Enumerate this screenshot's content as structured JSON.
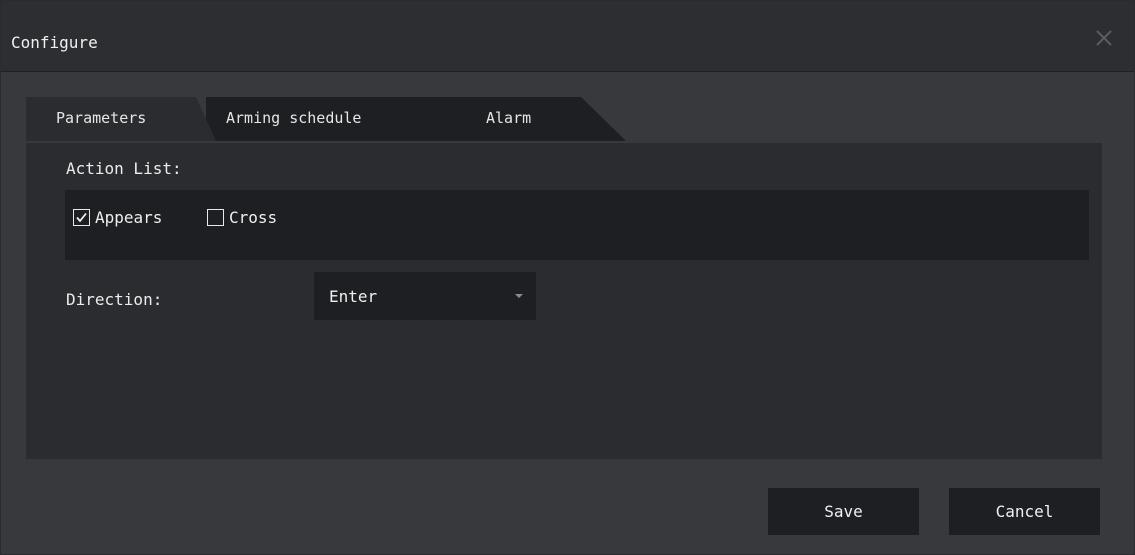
{
  "dialog": {
    "title": "Configure",
    "close_icon": "close-icon"
  },
  "tabs": [
    {
      "label": "Parameters",
      "active": true
    },
    {
      "label": "Arming schedule",
      "active": false
    },
    {
      "label": "Alarm",
      "active": false
    }
  ],
  "parameters": {
    "action_list_label": "Action List:",
    "actions": [
      {
        "label": "Appears",
        "checked": true
      },
      {
        "label": "Cross",
        "checked": false
      }
    ],
    "direction_label": "Direction:",
    "direction_value": "Enter"
  },
  "buttons": {
    "save": "Save",
    "cancel": "Cancel"
  },
  "colors": {
    "window_bg": "#37393d",
    "titlebar_bg": "#2d2e32",
    "panel_bg": "#2b2c30",
    "control_bg": "#1e1f22",
    "text": "#e8e8e8"
  }
}
